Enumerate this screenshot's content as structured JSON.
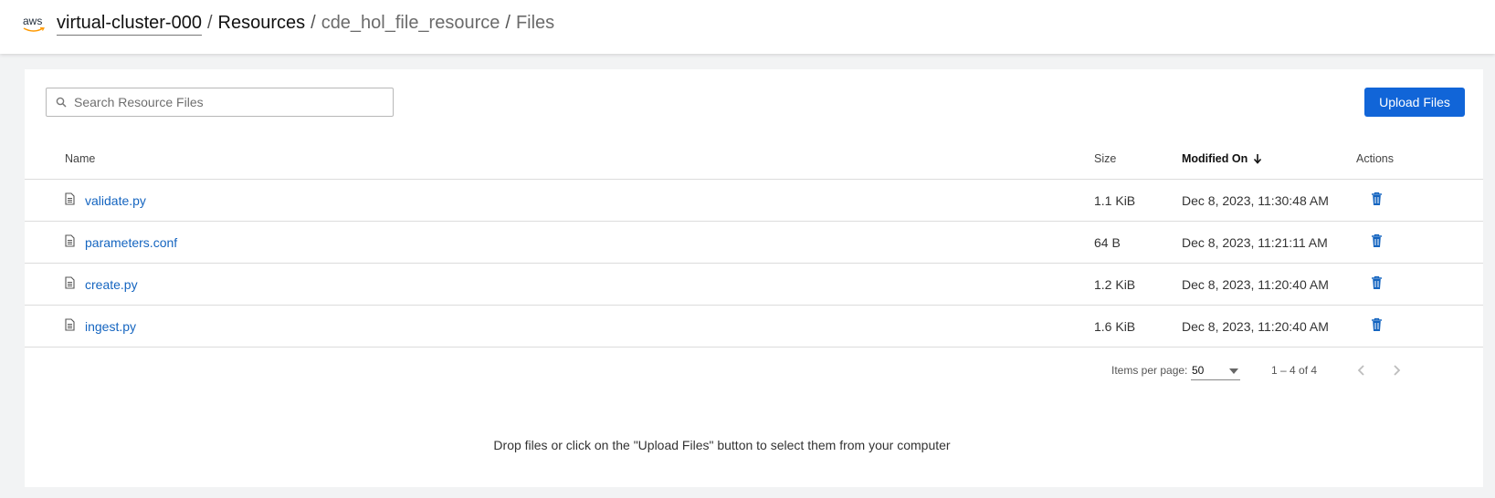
{
  "header": {
    "logo_text": "aws",
    "breadcrumbs": {
      "cluster": "virtual-cluster-000",
      "sep1": "/",
      "resources": "Resources",
      "sep2": "/",
      "resource": "cde_hol_file_resource",
      "sep3": "/",
      "current": "Files"
    }
  },
  "toolbar": {
    "search_placeholder": "Search Resource Files",
    "search_value": "",
    "upload_label": "Upload Files"
  },
  "table": {
    "columns": {
      "name": "Name",
      "size": "Size",
      "modified": "Modified On",
      "actions": "Actions"
    },
    "sort": {
      "column": "modified",
      "direction": "desc",
      "icon": "arrow-down-icon"
    },
    "rows": [
      {
        "name": "validate.py",
        "size": "1.1 KiB",
        "modified": "Dec 8, 2023, 11:30:48 AM"
      },
      {
        "name": "parameters.conf",
        "size": "64 B",
        "modified": "Dec 8, 2023, 11:21:11 AM"
      },
      {
        "name": "create.py",
        "size": "1.2 KiB",
        "modified": "Dec 8, 2023, 11:20:40 AM"
      },
      {
        "name": "ingest.py",
        "size": "1.6 KiB",
        "modified": "Dec 8, 2023, 11:20:40 AM"
      }
    ]
  },
  "pagination": {
    "items_per_page_label": "Items per page:",
    "items_per_page": "50",
    "range": "1 – 4 of 4"
  },
  "dropzone": {
    "text": "Drop files or click on the \"Upload Files\" button to select them from your computer"
  },
  "colors": {
    "accent": "#1165d8",
    "link": "#1565c0",
    "background": "#f2f3f4"
  }
}
